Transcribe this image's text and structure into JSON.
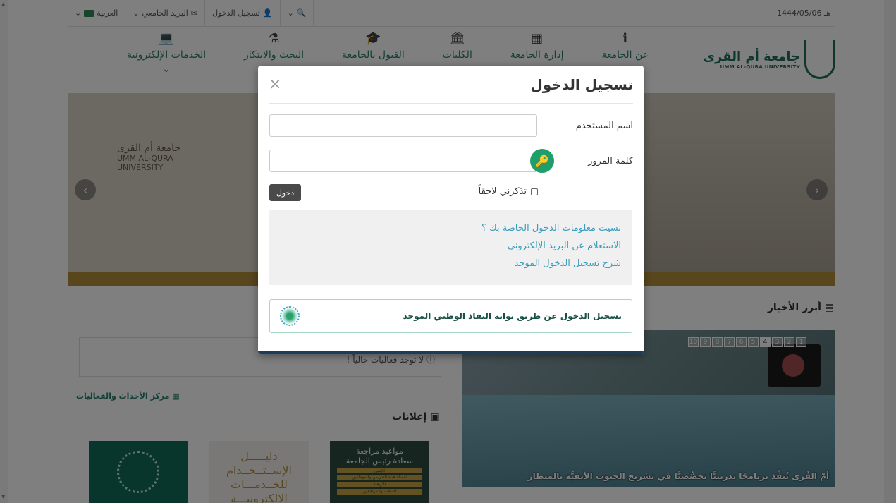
{
  "topbar": {
    "language": "العربية",
    "mail": "البريد الجامعي",
    "login": "تسجيل الدخول",
    "date": "1444/05/06 هـ"
  },
  "nav": [
    {
      "label": "عن الجامعة",
      "icon": "info-icon"
    },
    {
      "label": "إدارة الجامعة",
      "icon": "building-icon"
    },
    {
      "label": "الكليات",
      "icon": "institution-icon"
    },
    {
      "label": "القبول بالجامعة",
      "icon": "graduation-cap-icon"
    },
    {
      "label": "البحث والابتكار",
      "icon": "flask-icon"
    },
    {
      "label": "الخدمات الإلكترونية",
      "icon": "laptop-icon"
    }
  ],
  "logo": {
    "ar": "جامعة أم القرى",
    "en": "UMM AL-QURA UNIVERSITY"
  },
  "hero": {
    "sign_ar": "جامعة أم القرى",
    "sign_en1": "UMM AL-QURA",
    "sign_en2": "UNIVERSITY"
  },
  "news": {
    "title": "أبرز الأخبار",
    "pages": [
      "1",
      "2",
      "3",
      "4",
      "5",
      "6",
      "7",
      "8",
      "9",
      "10"
    ],
    "active_page": "4",
    "caption": "أمّ القُرى تُنفِّذ برنامجًا تدريبيًّا تخصُّصيًّا في تشريح الجيوب الأنفيَّة بالمنظار"
  },
  "events": {
    "empty": "لا توجد فعاليات حالياً !",
    "link": "مركز الأحداث والفعاليات"
  },
  "announcements": {
    "title": "إعلانات",
    "card2": [
      "دليـــــل",
      "الإســتــخــدام",
      "للخــدمـــات",
      "الالكترونيـــة"
    ],
    "card3": [
      "مواعيد مراجعة",
      "سعادة رئيس الجامعة"
    ],
    "card3_strips": [
      "الإثنين",
      "أعضاء هيئة التدريس والموظفين",
      "الأربعاء",
      "الطلاب والمراجعين"
    ]
  },
  "modal": {
    "title": "تسجيل الدخول",
    "close": "×",
    "username_label": "اسم المستخدم",
    "username_value": "",
    "password_label": "كلمة المرور",
    "password_value": "",
    "remember": "تذكرني لاحقاً",
    "login_button": "دخول",
    "links": [
      "نسيت معلومات الدخول الخاصة بك ؟",
      "الاستعلام عن البريد الإلكتروني",
      "شرح تسجيل الدخول الموحد"
    ],
    "nafath": "تسجيل الدخول عن طريق بوابة النفاذ الوطني الموحد"
  },
  "colors": {
    "brand": "#1f6f5c",
    "link": "#3b9dbd",
    "gold": "#b08d3a",
    "key": "#1e9e6b"
  }
}
